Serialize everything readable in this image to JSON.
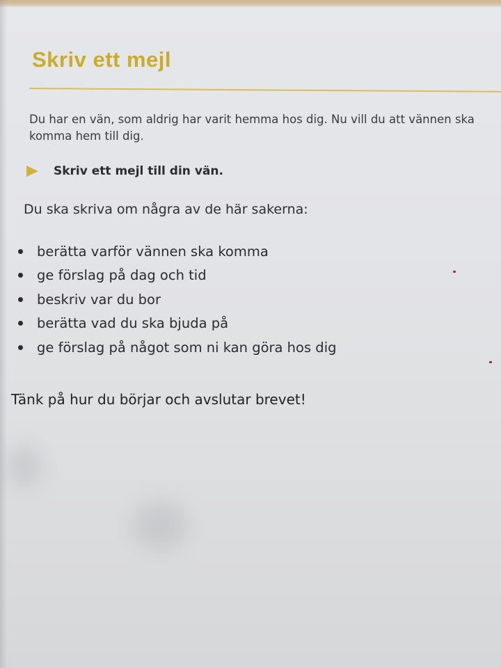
{
  "heading": "Skriv ett mejl",
  "intro": "Du har en vän, som aldrig har varit hemma hos dig. Nu vill du att vännen ska komma hem till dig.",
  "instruction": "Skriv ett mejl till din vän.",
  "lead": "Du ska skriva om några av de här sakerna:",
  "items": [
    {
      "text": "berätta varför vännen ska komma"
    },
    {
      "text": "ge förslag på dag och tid"
    },
    {
      "text": "beskriv var du bor"
    },
    {
      "text": "berätta vad du ska bjuda på"
    },
    {
      "text": "ge förslag på något som ni kan göra hos dig"
    }
  ],
  "closing": "Tänk på hur du börjar och avslutar brevet!",
  "colors": {
    "heading": "#c9ac27",
    "rule": "#d6bf5a",
    "arrow": "#cfb33a",
    "paper": "#e3e4e7",
    "text": "#2b2b2f"
  },
  "icons": {
    "instruction_marker": "triangle-right-icon",
    "list_marker": "bullet-dot-icon"
  }
}
